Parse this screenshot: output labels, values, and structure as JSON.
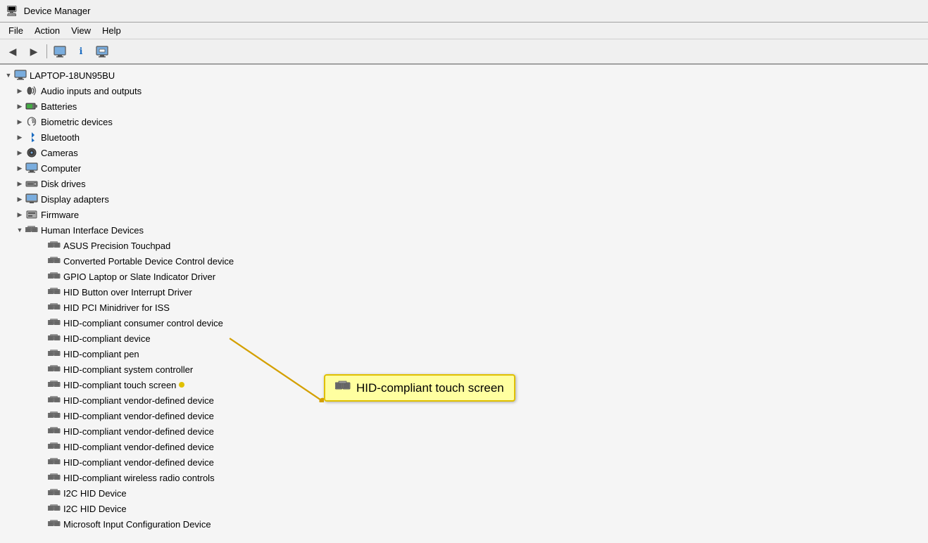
{
  "titleBar": {
    "title": "Device Manager",
    "icon": "🖥"
  },
  "menuBar": {
    "items": [
      "File",
      "Action",
      "View",
      "Help"
    ]
  },
  "toolbar": {
    "buttons": [
      {
        "name": "back",
        "icon": "◀",
        "label": "Back"
      },
      {
        "name": "forward",
        "icon": "▶",
        "label": "Forward"
      },
      {
        "name": "properties",
        "icon": "🖥",
        "label": "Properties"
      },
      {
        "name": "info",
        "icon": "ℹ",
        "label": "Update Driver"
      },
      {
        "name": "scan",
        "icon": "🖥",
        "label": "Scan for hardware changes"
      }
    ]
  },
  "tree": {
    "root": {
      "label": "LAPTOP-18UN95BU",
      "expanded": true
    },
    "items": [
      {
        "id": "audio",
        "label": "Audio inputs and outputs",
        "indent": 1,
        "expandable": true,
        "expanded": false,
        "icon": "audio"
      },
      {
        "id": "batteries",
        "label": "Batteries",
        "indent": 1,
        "expandable": true,
        "expanded": false,
        "icon": "battery"
      },
      {
        "id": "biometric",
        "label": "Biometric devices",
        "indent": 1,
        "expandable": true,
        "expanded": false,
        "icon": "biometric"
      },
      {
        "id": "bluetooth",
        "label": "Bluetooth",
        "indent": 1,
        "expandable": true,
        "expanded": false,
        "icon": "bluetooth"
      },
      {
        "id": "cameras",
        "label": "Cameras",
        "indent": 1,
        "expandable": true,
        "expanded": false,
        "icon": "camera"
      },
      {
        "id": "computer",
        "label": "Computer",
        "indent": 1,
        "expandable": true,
        "expanded": false,
        "icon": "computer"
      },
      {
        "id": "disk",
        "label": "Disk drives",
        "indent": 1,
        "expandable": true,
        "expanded": false,
        "icon": "disk"
      },
      {
        "id": "display",
        "label": "Display adapters",
        "indent": 1,
        "expandable": true,
        "expanded": false,
        "icon": "display"
      },
      {
        "id": "firmware",
        "label": "Firmware",
        "indent": 1,
        "expandable": true,
        "expanded": false,
        "icon": "firmware"
      },
      {
        "id": "hid",
        "label": "Human Interface Devices",
        "indent": 1,
        "expandable": true,
        "expanded": true,
        "icon": "hid"
      },
      {
        "id": "hid-asus",
        "label": "ASUS Precision Touchpad",
        "indent": 2,
        "expandable": false,
        "icon": "hid-device"
      },
      {
        "id": "hid-converted",
        "label": "Converted Portable Device Control device",
        "indent": 2,
        "expandable": false,
        "icon": "hid-device"
      },
      {
        "id": "hid-gpio",
        "label": "GPIO Laptop or Slate Indicator Driver",
        "indent": 2,
        "expandable": false,
        "icon": "hid-device"
      },
      {
        "id": "hid-button",
        "label": "HID Button over Interrupt Driver",
        "indent": 2,
        "expandable": false,
        "icon": "hid-device"
      },
      {
        "id": "hid-pci",
        "label": "HID PCI Minidriver for ISS",
        "indent": 2,
        "expandable": false,
        "icon": "hid-device"
      },
      {
        "id": "hid-consumer",
        "label": "HID-compliant consumer control device",
        "indent": 2,
        "expandable": false,
        "icon": "hid-device"
      },
      {
        "id": "hid-device1",
        "label": "HID-compliant device",
        "indent": 2,
        "expandable": false,
        "icon": "hid-device"
      },
      {
        "id": "hid-pen",
        "label": "HID-compliant pen",
        "indent": 2,
        "expandable": false,
        "icon": "hid-device"
      },
      {
        "id": "hid-system",
        "label": "HID-compliant system controller",
        "indent": 2,
        "expandable": false,
        "icon": "hid-device"
      },
      {
        "id": "hid-touch",
        "label": "HID-compliant touch screen",
        "indent": 2,
        "expandable": false,
        "icon": "hid-device",
        "highlighted": true
      },
      {
        "id": "hid-vendor1",
        "label": "HID-compliant vendor-defined device",
        "indent": 2,
        "expandable": false,
        "icon": "hid-device"
      },
      {
        "id": "hid-vendor2",
        "label": "HID-compliant vendor-defined device",
        "indent": 2,
        "expandable": false,
        "icon": "hid-device"
      },
      {
        "id": "hid-vendor3",
        "label": "HID-compliant vendor-defined device",
        "indent": 2,
        "expandable": false,
        "icon": "hid-device"
      },
      {
        "id": "hid-vendor4",
        "label": "HID-compliant vendor-defined device",
        "indent": 2,
        "expandable": false,
        "icon": "hid-device"
      },
      {
        "id": "hid-vendor5",
        "label": "HID-compliant vendor-defined device",
        "indent": 2,
        "expandable": false,
        "icon": "hid-device"
      },
      {
        "id": "hid-wireless",
        "label": "HID-compliant wireless radio controls",
        "indent": 2,
        "expandable": false,
        "icon": "hid-device"
      },
      {
        "id": "hid-i2c1",
        "label": "I2C HID Device",
        "indent": 2,
        "expandable": false,
        "icon": "hid-device"
      },
      {
        "id": "hid-i2c2",
        "label": "I2C HID Device",
        "indent": 2,
        "expandable": false,
        "icon": "hid-device"
      },
      {
        "id": "hid-ms-input",
        "label": "Microsoft Input Configuration Device",
        "indent": 2,
        "expandable": false,
        "icon": "hid-device"
      }
    ]
  },
  "callout": {
    "label": "HID-compliant touch screen",
    "icon": "hid-device"
  }
}
